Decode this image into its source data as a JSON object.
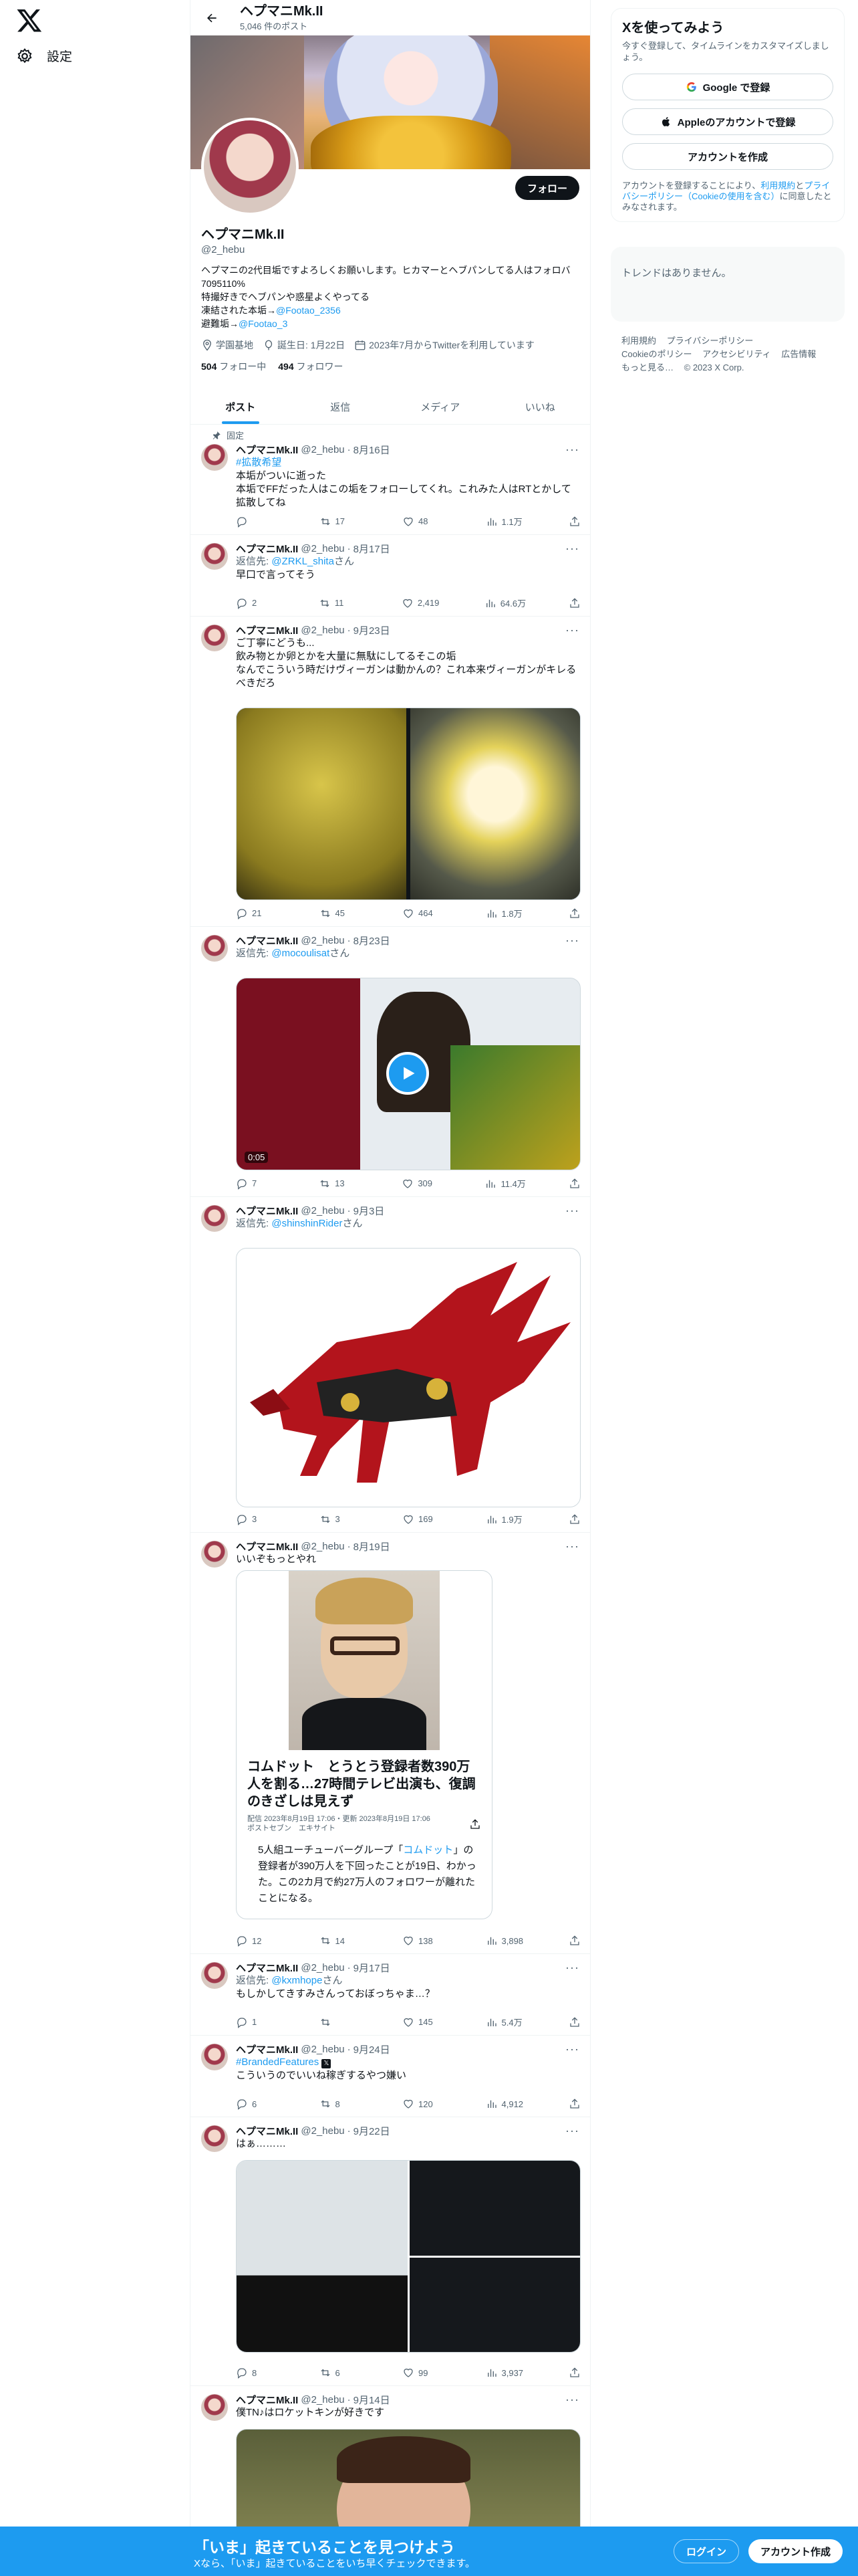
{
  "nav": {
    "settings_label": "設定"
  },
  "topbar": {
    "name": "ヘプマニMk.II",
    "post_count": "5,046 件のポスト"
  },
  "profile": {
    "follow_label": "フォロー",
    "name": "ヘプマニMk.II",
    "handle": "@2_hebu",
    "bio_line1": "ヘプマニの2代目垢ですよろしくお願いします。ヒカマーとヘブパンしてる人はフォロバ7095110%",
    "bio_line2": "特撮好きでヘブパンや惑星よくやってる",
    "bio_line3_prefix": "凍結された本垢→",
    "bio_line3_link": "@Footao_2356",
    "bio_line4_prefix": "避難垢→",
    "bio_line4_link": "@Footao_3",
    "location": "学園基地",
    "birthday": "誕生日: 1月22日",
    "joined": "2023年7月からTwitterを利用しています",
    "following_count": "504",
    "following_label": "フォロー中",
    "followers_count": "494",
    "followers_label": "フォロワー"
  },
  "tabs": [
    "ポスト",
    "返信",
    "メディア",
    "いいね"
  ],
  "pinned_label": "固定",
  "tweets": [
    {
      "name": "ヘプマニMk.II",
      "handle": "@2_hebu",
      "date": "8月16日",
      "hashtag": "#拡散希望",
      "line1": "本垢がついに逝った",
      "line2": "本垢でFFだった人はこの垢をフォローしてくれ。これみた人はRTとかして拡散してね",
      "replies": "",
      "retweets": "17",
      "likes": "48",
      "views": "1.1万"
    },
    {
      "name": "ヘプマニMk.II",
      "handle": "@2_hebu",
      "date": "8月17日",
      "reply_prefix": "返信先: ",
      "reply_to": "@ZRKL_shita",
      "reply_suffix": "さん",
      "line1": "早口で言ってそう",
      "replies": "2",
      "retweets": "11",
      "likes": "2,419",
      "views": "64.6万"
    },
    {
      "name": "ヘプマニMk.II",
      "handle": "@2_hebu",
      "date": "9月23日",
      "line1": "ご丁寧にどうも...",
      "line2": "飲み物とか卵とかを大量に無駄にしてるそこの垢",
      "line3": "なんでこういう時だけヴィーガンは動かんの？これ本来ヴィーガンがキレるべきだろ",
      "replies": "21",
      "retweets": "45",
      "likes": "464",
      "views": "1.8万"
    },
    {
      "name": "ヘプマニMk.II",
      "handle": "@2_hebu",
      "date": "8月23日",
      "reply_prefix": "返信先: ",
      "reply_to": "@mocoulisat",
      "reply_suffix": "さん",
      "video_time": "0:05",
      "replies": "7",
      "retweets": "13",
      "likes": "309",
      "views": "11.4万"
    },
    {
      "name": "ヘプマニMk.II",
      "handle": "@2_hebu",
      "date": "9月3日",
      "reply_prefix": "返信先: ",
      "reply_to": "@shinshinRider",
      "reply_suffix": "さん",
      "replies": "3",
      "retweets": "3",
      "likes": "169",
      "views": "1.9万"
    },
    {
      "name": "ヘプマニMk.II",
      "handle": "@2_hebu",
      "date": "8月19日",
      "line1": "いいぞもっとやれ",
      "card_title": "コムドット　とうとう登録者数390万人を割る…27時間テレビ出演も、復調のきざしは見えず",
      "card_meta": "配信 2023年8月19日 17:06・更新 2023年8月19日 17:06",
      "card_source": "ポストセブン　エキサイト",
      "card_body_prefix": "5人組ユーチューバーグループ「",
      "card_body_link": "コムドット",
      "card_body_suffix": "」の登録者が390万人を下回ったことが19日、わかった。この2カ月で約27万人のフォロワーが離れたことになる。",
      "replies": "12",
      "retweets": "14",
      "likes": "138",
      "views": "3,898"
    },
    {
      "name": "ヘプマニMk.II",
      "handle": "@2_hebu",
      "date": "9月17日",
      "reply_prefix": "返信先: ",
      "reply_to": "@kxmhope",
      "reply_suffix": "さん",
      "line1": "もしかしてきすみさんっておぼっちゃま…？",
      "replies": "1",
      "retweets": "",
      "likes": "145",
      "views": "5.4万"
    },
    {
      "name": "ヘプマニMk.II",
      "handle": "@2_hebu",
      "date": "9月24日",
      "hashtag": "#BrandedFeatures",
      "line1": "こういうのでいいね稼ぎするやつ嫌い",
      "replies": "6",
      "retweets": "8",
      "likes": "120",
      "views": "4,912"
    },
    {
      "name": "ヘプマニMk.II",
      "handle": "@2_hebu",
      "date": "9月22日",
      "line1": "はぁ………",
      "replies": "8",
      "retweets": "6",
      "likes": "99",
      "views": "3,937"
    },
    {
      "name": "ヘプマニMk.II",
      "handle": "@2_hebu",
      "date": "9月14日",
      "line1": "僕TN♪はロケットキンが好きです"
    }
  ],
  "sidebar": {
    "signup_title": "Xを使ってみよう",
    "signup_sub": "今すぐ登録して、タイムラインをカスタマイズしましょう。",
    "google_label": "Google で登録",
    "apple_label": "Appleのアカウントで登録",
    "create_label": "アカウントを作成",
    "terms_prefix": "アカウントを登録することにより、",
    "terms_link1": "利用規約",
    "terms_mid": "と",
    "terms_link2": "プライバシーポリシー（Cookieの使用を含む）",
    "terms_suffix": "に同意したとみなされます。",
    "trends_empty": "トレンドはありません。",
    "footer": [
      "利用規約",
      "プライバシーポリシー",
      "Cookieのポリシー",
      "アクセシビリティ",
      "広告情報",
      "もっと見る…",
      "© 2023 X Corp."
    ]
  },
  "bottombar": {
    "title": "「いま」起きていることを見つけよう",
    "subtitle": "Xなら、「いま」起きていることをいち早くチェックできます。",
    "login_label": "ログイン",
    "create_label": "アカウント作成"
  },
  "colors": {
    "accent": "#1d9bf0",
    "text": "#0f1419",
    "muted": "#536471"
  },
  "icons": [
    "x-logo-icon",
    "gear-icon",
    "back-arrow-icon",
    "location-icon",
    "balloon-icon",
    "calendar-icon",
    "pin-icon",
    "reply-icon",
    "retweet-icon",
    "like-icon",
    "views-icon",
    "share-icon",
    "more-icon",
    "play-icon",
    "google-icon",
    "apple-icon"
  ]
}
